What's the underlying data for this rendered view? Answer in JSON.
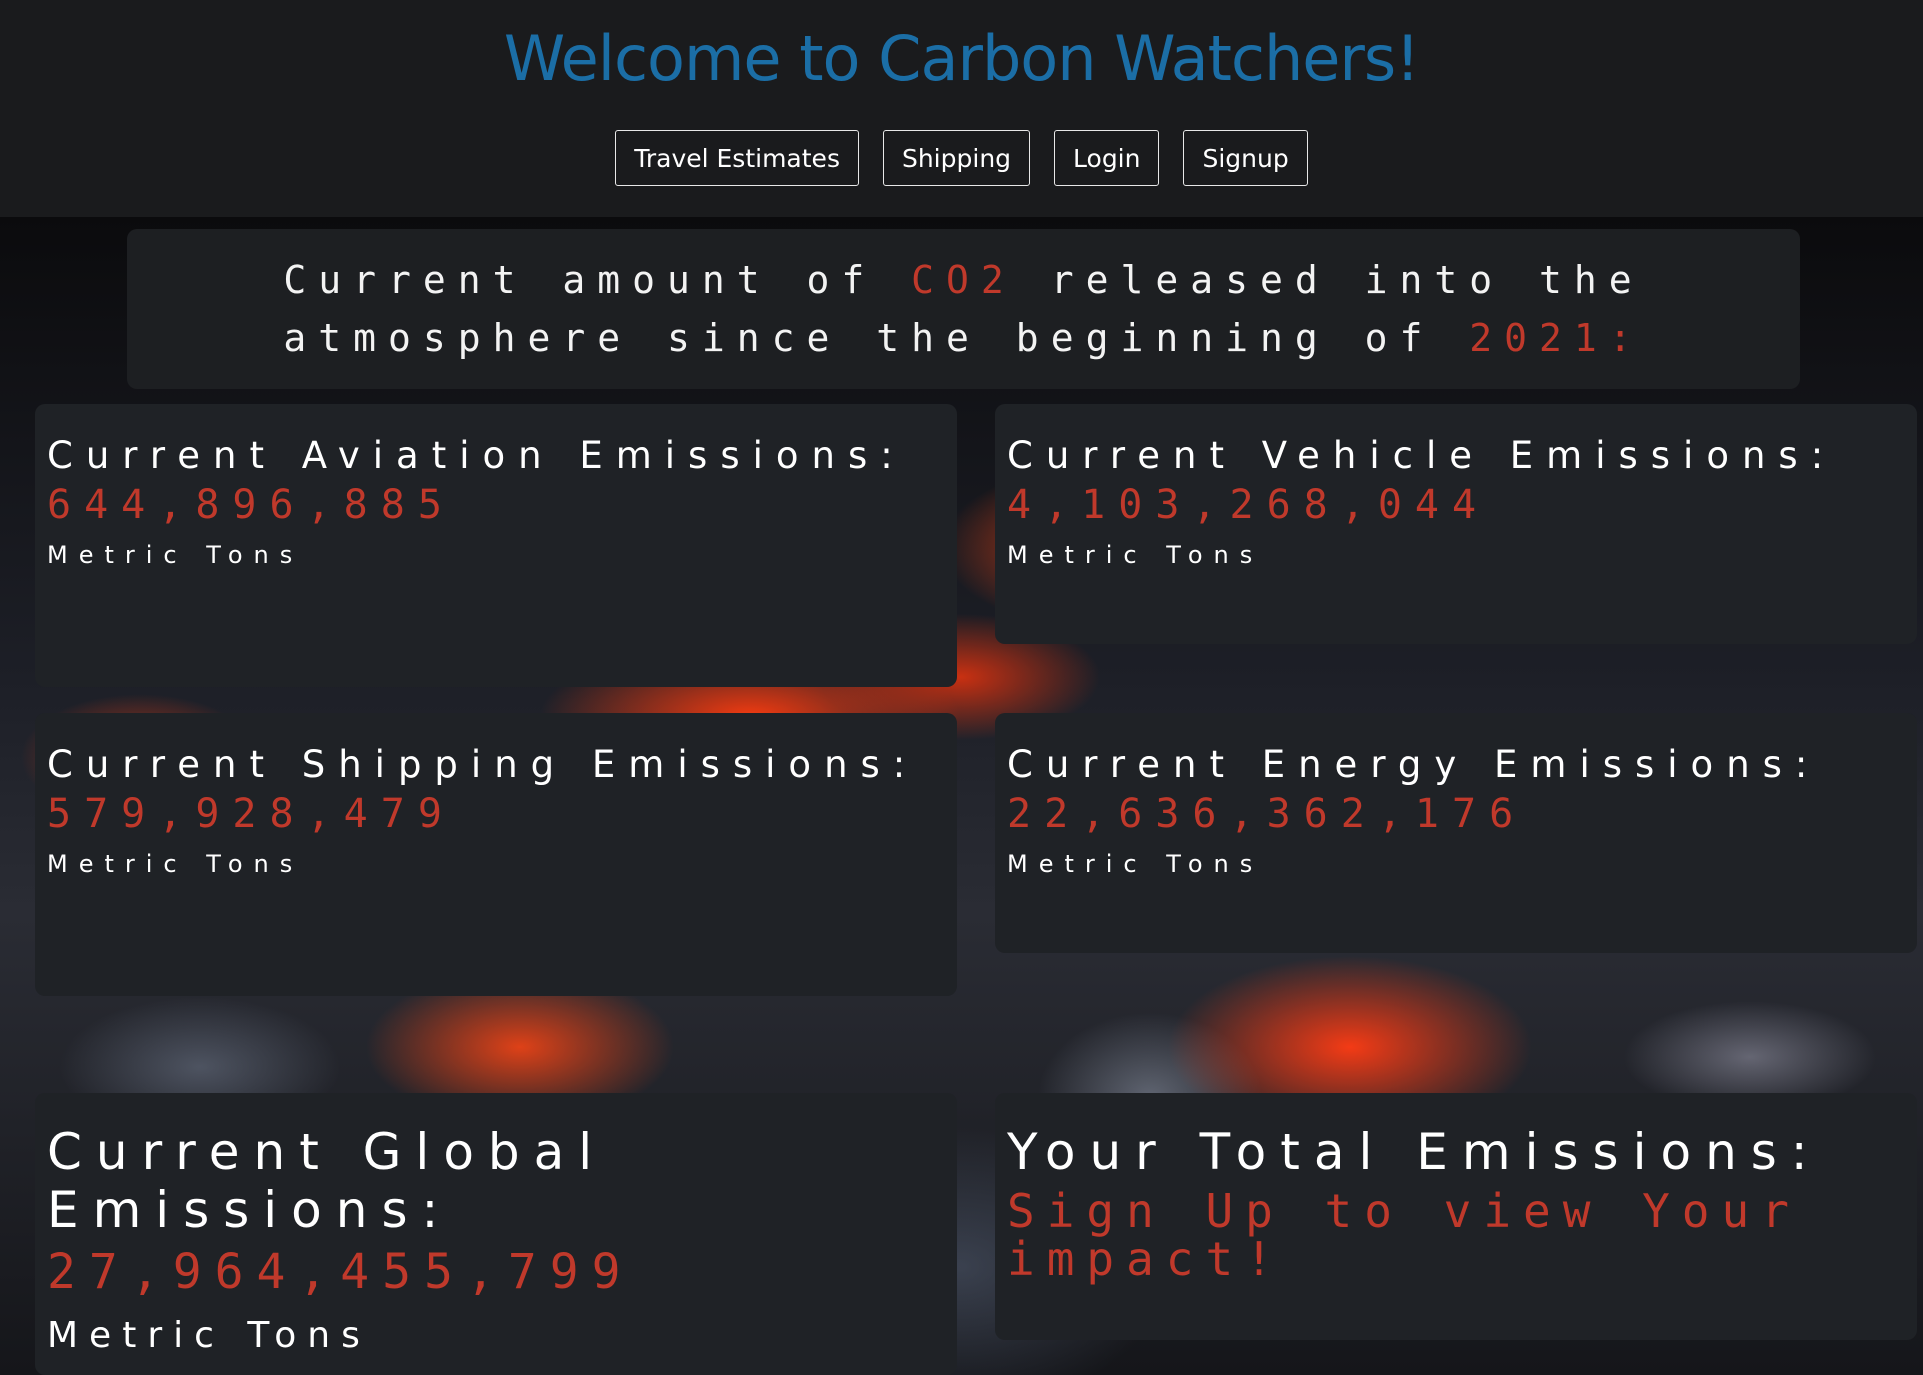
{
  "header": {
    "title": "Welcome to Carbon Watchers!",
    "nav": [
      "Travel Estimates",
      "Shipping",
      "Login",
      "Signup"
    ]
  },
  "banner": {
    "text_part1": "Current amount of ",
    "highlight1": "CO2",
    "text_part2": " released into the atmosphere since the beginning of ",
    "highlight2": "2021:"
  },
  "cards": {
    "aviation": {
      "title": "Current Aviation Emissions:",
      "value": "644,896,885",
      "unit": "Metric Tons"
    },
    "vehicle": {
      "title": "Current Vehicle Emissions:",
      "value": "4,103,268,044",
      "unit": "Metric Tons"
    },
    "shipping": {
      "title": "Current Shipping Emissions:",
      "value": "579,928,479",
      "unit": "Metric Tons"
    },
    "energy": {
      "title": "Current Energy Emissions:",
      "value": "22,636,362,176",
      "unit": "Metric Tons"
    },
    "global": {
      "title": "Current Global Emissions:",
      "value": "27,964,455,799",
      "unit": "Metric Tons"
    },
    "total": {
      "title": "Your Total Emissions:",
      "cta": "Sign Up to view Your impact!"
    }
  },
  "colors": {
    "title_blue": "#1b6ea6",
    "value_red": "#c0392b",
    "card_bg": "#1f2226",
    "header_bg": "#1a1b1d"
  }
}
